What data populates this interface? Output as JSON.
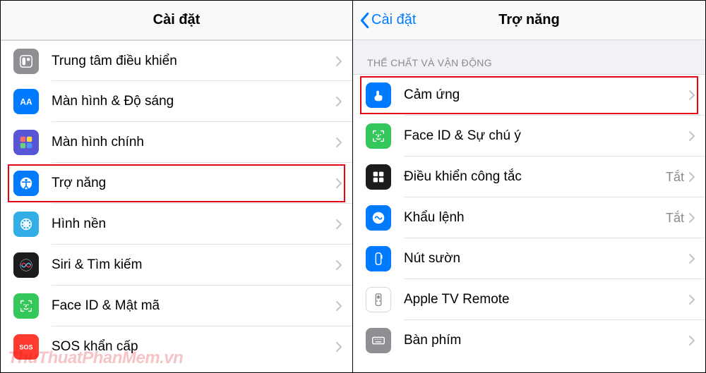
{
  "left": {
    "title": "Cài đặt",
    "rows": [
      {
        "label": "Trung tâm điều khiển",
        "icon": "control-center-icon",
        "color": "bg-gray"
      },
      {
        "label": "Màn hình & Độ sáng",
        "icon": "display-icon",
        "color": "bg-blue"
      },
      {
        "label": "Màn hình chính",
        "icon": "home-screen-icon",
        "color": "bg-indigo"
      },
      {
        "label": "Trợ năng",
        "icon": "accessibility-icon",
        "color": "bg-blue",
        "highlight": true
      },
      {
        "label": "Hình nền",
        "icon": "wallpaper-icon",
        "color": "bg-cyan"
      },
      {
        "label": "Siri & Tìm kiếm",
        "icon": "siri-icon",
        "color": "bg-dark"
      },
      {
        "label": "Face ID & Mật mã",
        "icon": "faceid-icon",
        "color": "bg-green"
      },
      {
        "label": "SOS khẩn cấp",
        "icon": "sos-icon",
        "color": "bg-red"
      }
    ]
  },
  "right": {
    "back": "Cài đặt",
    "title": "Trợ năng",
    "section": "THỂ CHẤT VÀ VẬN ĐỘNG",
    "rows": [
      {
        "label": "Cảm ứng",
        "icon": "touch-icon",
        "color": "bg-blue",
        "highlight": true
      },
      {
        "label": "Face ID & Sự chú ý",
        "icon": "faceid-icon",
        "color": "bg-green"
      },
      {
        "label": "Điều khiển công tắc",
        "icon": "switch-control-icon",
        "color": "bg-dark",
        "value": "Tắt"
      },
      {
        "label": "Khẩu lệnh",
        "icon": "voice-control-icon",
        "color": "bg-blue",
        "value": "Tắt"
      },
      {
        "label": "Nút sườn",
        "icon": "side-button-icon",
        "color": "bg-blue"
      },
      {
        "label": "Apple TV Remote",
        "icon": "remote-icon",
        "color": "bg-white-border"
      },
      {
        "label": "Bàn phím",
        "icon": "keyboard-icon",
        "color": "bg-gray"
      }
    ]
  },
  "watermark": "ThuThuatPhanMem.vn"
}
